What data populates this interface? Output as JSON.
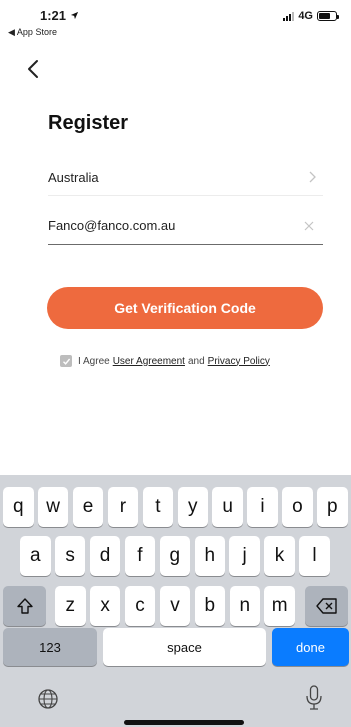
{
  "status_bar": {
    "time": "1:21",
    "back_app": "◀ App Store",
    "network": "4G",
    "battery_level": 0.7
  },
  "page": {
    "title": "Register"
  },
  "form": {
    "country": "Australia",
    "email": "Fanco@fanco.com.au"
  },
  "button": {
    "label": "Get Verification Code"
  },
  "agreement": {
    "prefix": "I Agree",
    "user_agreement": "User Agreement",
    "and": "and",
    "privacy_policy": "Privacy Policy",
    "checked": true
  },
  "keyboard": {
    "row1": [
      "q",
      "w",
      "e",
      "r",
      "t",
      "y",
      "u",
      "i",
      "o",
      "p"
    ],
    "row2": [
      "a",
      "s",
      "d",
      "f",
      "g",
      "h",
      "j",
      "k",
      "l"
    ],
    "row3": [
      "z",
      "x",
      "c",
      "v",
      "b",
      "n",
      "m"
    ],
    "numbers_label": "123",
    "space_label": "space",
    "done_label": "done"
  },
  "colors": {
    "accent": "#ee6a3e",
    "done_key": "#0a7cff",
    "keyboard_bg": "#d1d4d9"
  }
}
